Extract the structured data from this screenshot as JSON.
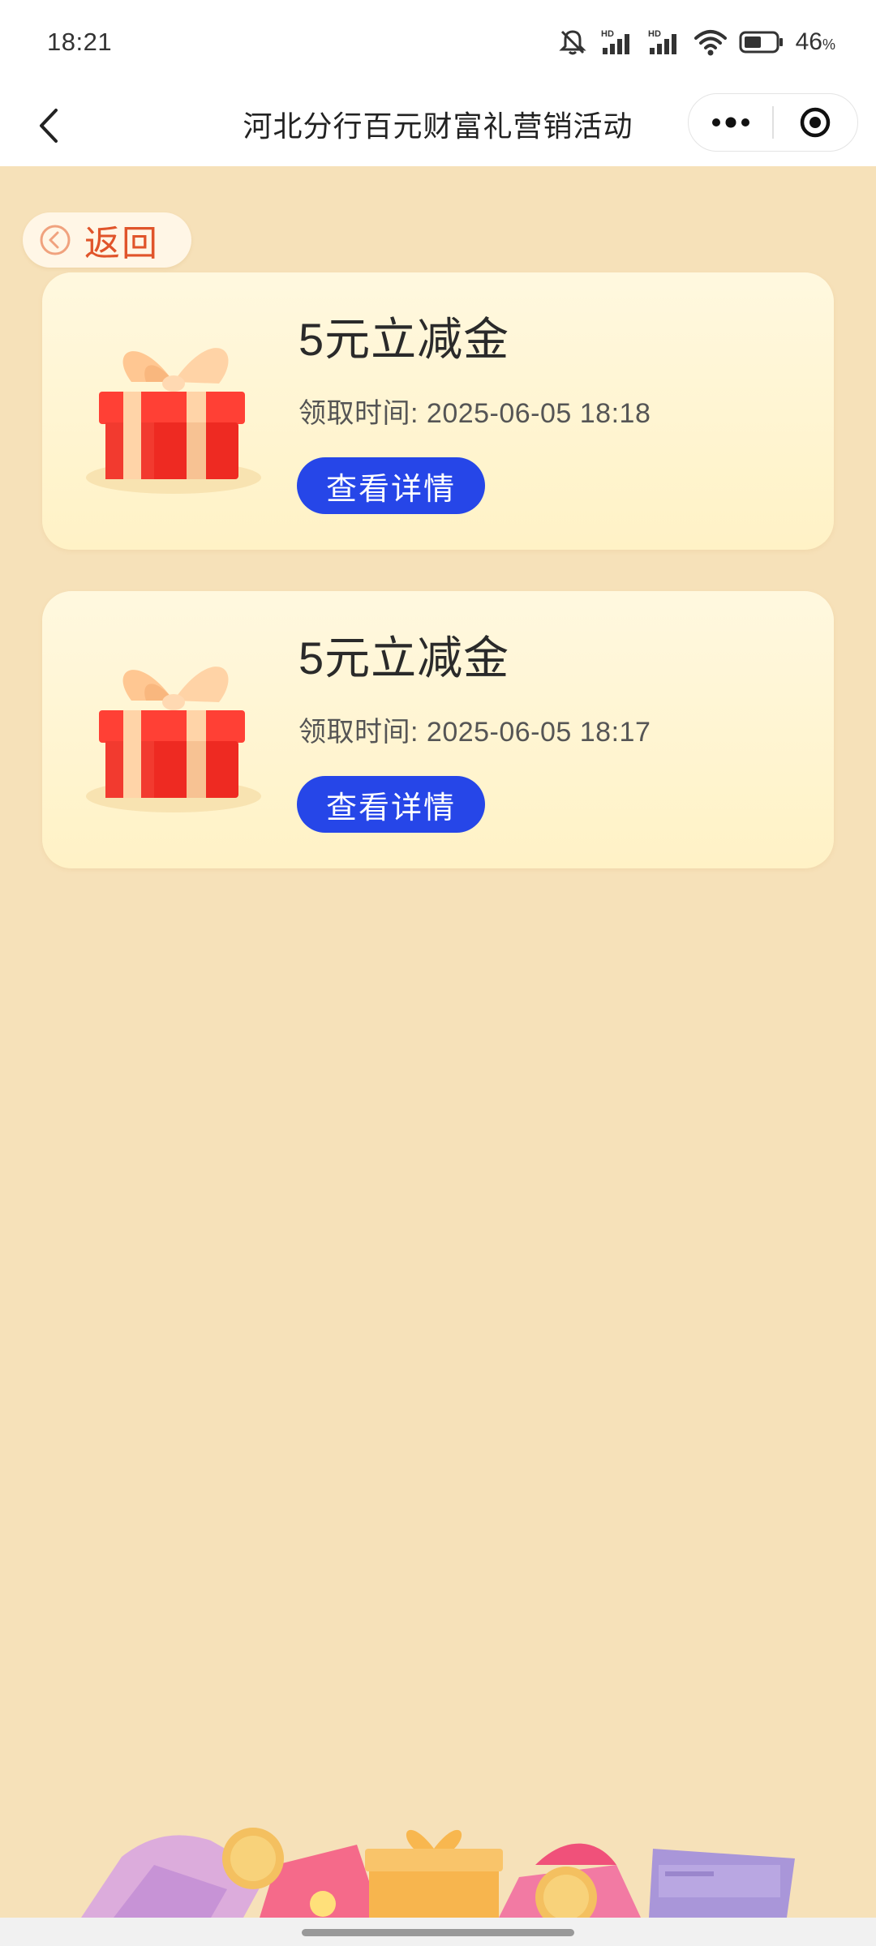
{
  "status_bar": {
    "time": "18:21",
    "battery_percent": "46",
    "battery_unit": "%",
    "icons": [
      "mute-icon",
      "hd-signal-icon",
      "hd-signal-icon",
      "wifi-icon",
      "battery-icon"
    ]
  },
  "nav": {
    "title": "河北分行百元财富礼营销活动",
    "back_icon": "chevron-left-icon",
    "more_icon": "more-dots-icon",
    "close_icon": "target-close-icon"
  },
  "back_button": {
    "label": "返回",
    "icon": "circle-chevron-left-icon"
  },
  "rewards": [
    {
      "title": "5元立减金",
      "time_label": "领取时间:",
      "time_value": "2025-06-05 18:18",
      "button_label": "查看详情",
      "icon": "gift-box-icon"
    },
    {
      "title": "5元立减金",
      "time_label": "领取时间:",
      "time_value": "2025-06-05 18:17",
      "button_label": "查看详情",
      "icon": "gift-box-icon"
    }
  ],
  "colors": {
    "page_bg": "#f6e1b9",
    "card_bg": "#fff5d6",
    "button_bg": "#2646e8",
    "back_label": "#e0542a"
  }
}
